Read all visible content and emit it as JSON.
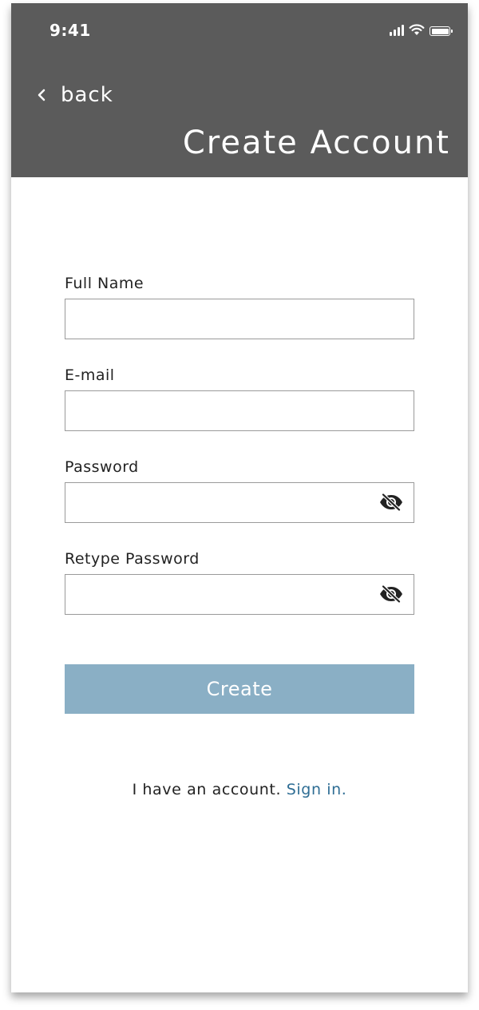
{
  "status_bar": {
    "time": "9:41",
    "icons": [
      "signal-icon",
      "wifi-icon",
      "battery-icon"
    ]
  },
  "header": {
    "back_label": "back",
    "title": "Create Account",
    "background_color": "#5b5b5b"
  },
  "form": {
    "fields": [
      {
        "label": "Full Name",
        "value": "",
        "placeholder": ""
      },
      {
        "label": "E-mail",
        "value": "",
        "placeholder": ""
      },
      {
        "label": "Password",
        "value": "",
        "placeholder": "",
        "icon": "eye-slash-icon"
      },
      {
        "label": "Retype Password",
        "value": "",
        "placeholder": "",
        "icon": "eye-slash-icon"
      }
    ],
    "submit_label": "Create",
    "submit_color": "#8aafc5"
  },
  "footer": {
    "prompt": "I have an account.",
    "link": "Sign in.",
    "link_color": "#2e6d94"
  }
}
